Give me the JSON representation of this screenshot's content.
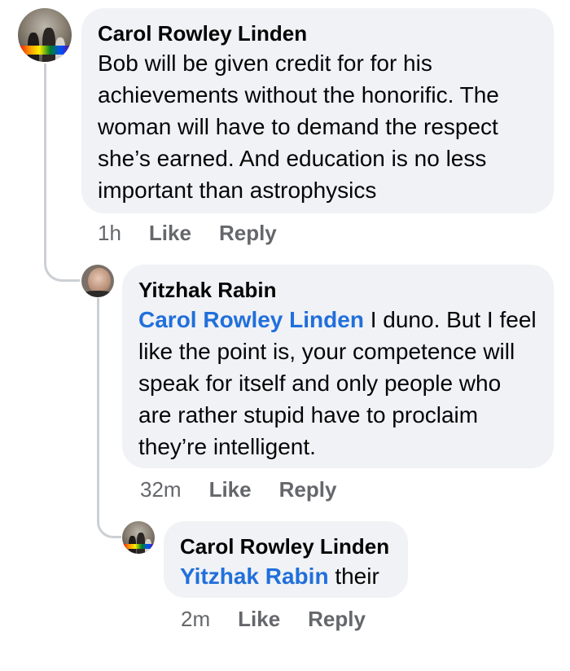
{
  "comments": [
    {
      "author": "Carol Rowley Linden",
      "mention": "",
      "text": "Bob will be given credit for for his achievements without the honorific. The woman will have to demand the respect she’s earned. And education is no less important than astrophysics",
      "time": "1h",
      "like_label": "Like",
      "reply_label": "Reply"
    },
    {
      "author": "Yitzhak Rabin",
      "mention": "Carol Rowley Linden",
      "text": " I duno. But I feel like the point is, your competence will speak for itself and only people who are rather stupid have to proclaim they’re intelligent.",
      "time": "32m",
      "like_label": "Like",
      "reply_label": "Reply"
    },
    {
      "author": "Carol Rowley Linden",
      "mention": "Yitzhak Rabin",
      "text": " their",
      "time": "2m",
      "like_label": "Like",
      "reply_label": "Reply"
    }
  ],
  "colors": {
    "bubble": "#f0f2f5",
    "mention": "#216fdb",
    "meta": "#65676b",
    "thread_line": "#ccd0d5"
  }
}
